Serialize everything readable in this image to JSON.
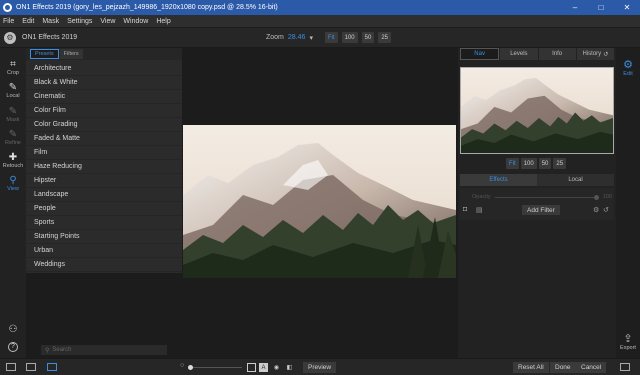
{
  "window": {
    "title": "ON1 Effects 2019 (gory_les_pejzazh_149986_1920x1080 copy.psd @ 28.5% 16-bit)",
    "controls": [
      "–",
      "□",
      "✕"
    ]
  },
  "menu": [
    "File",
    "Edit",
    "Mask",
    "Settings",
    "View",
    "Window",
    "Help"
  ],
  "topbar": {
    "app_name": "ON1 Effects 2019",
    "zoom_label": "Zoom",
    "zoom_value": "28.46",
    "zoom_arrow": "▾",
    "zoom_buttons": [
      "Fit",
      "100",
      "50",
      "25"
    ]
  },
  "left_tools": [
    {
      "label": "Crop",
      "icon": "crop-icon",
      "glyph": "⌗"
    },
    {
      "label": "Local",
      "icon": "brush-icon",
      "glyph": "✎"
    },
    {
      "label": "Mask",
      "icon": "mask-brush-icon",
      "glyph": "✎"
    },
    {
      "label": "Refine",
      "icon": "refine-brush-icon",
      "glyph": "✎"
    },
    {
      "label": "Retouch",
      "icon": "retouch-icon",
      "glyph": "✚"
    },
    {
      "label": "View",
      "icon": "view-icon",
      "glyph": "⚲"
    }
  ],
  "bottom_left_icons": [
    {
      "icon": "user-icon",
      "glyph": "⚇"
    },
    {
      "icon": "help-icon",
      "glyph": "?"
    }
  ],
  "presets": {
    "tabs": [
      "Presets",
      "Filters"
    ],
    "items": [
      "Architecture",
      "Black & White",
      "Cinematic",
      "Color Film",
      "Color Grading",
      "Faded & Matte",
      "Film",
      "Haze Reducing",
      "Hipster",
      "Landscape",
      "People",
      "Sports",
      "Starting Points",
      "Urban",
      "Weddings"
    ]
  },
  "search": {
    "placeholder": "Search",
    "icon_glyph": "⚲"
  },
  "right_panel": {
    "tabs": [
      "Nav",
      "Levels",
      "Info",
      "History"
    ],
    "history_icon": "↺",
    "nav_zoom_buttons": [
      "Fit",
      "100",
      "50",
      "25"
    ],
    "effect_tabs": [
      "Effects",
      "Local"
    ],
    "opacity_label": "Opacity",
    "opacity_value": "100",
    "add_filter_label": "Add Filter"
  },
  "right_strip": {
    "edit_label": "Edit",
    "export_label": "Export"
  },
  "bottom": {
    "preview_label": "Preview",
    "reset_all_label": "Reset All",
    "done_label": "Done",
    "cancel_label": "Cancel",
    "compare_glyph": "A"
  },
  "colors": {
    "accent": "#3b8fe0",
    "titlebar": "#2b5aa8"
  }
}
